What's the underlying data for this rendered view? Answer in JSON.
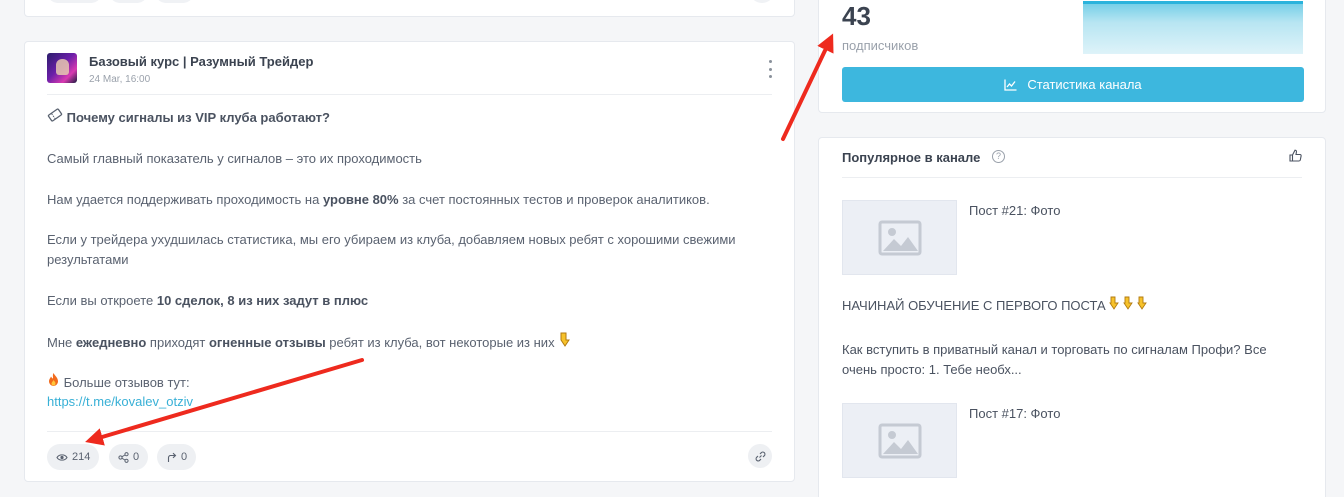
{
  "post": {
    "channel_name": "Базовый курс | Разумный Трейдер",
    "date": "24 Mar, 16:00",
    "heading": "Почему сигналы из VIP клуба работают?",
    "p1": "Самый главный показатель у сигналов – это их проходимость",
    "p2_before": "Нам удается поддерживать проходимость на ",
    "p2_bold": "уровне 80%",
    "p2_after": " за счет постоянных тестов и проверок аналитиков.",
    "p3_line1": "Если у трейдера ухудшилась статистика, мы его убираем из клуба, добавляем новых ребят с хорошими свежими",
    "p3_line2": "результатами",
    "p4_before": "Если вы откроете ",
    "p4_bold": "10 сделок, 8 из них задут в плюс",
    "p5_before": "Мне ",
    "p5_bold1": "ежедневно",
    "p5_mid1": " приходят ",
    "p5_bold2": "огненные отзывы",
    "p5_after": " ребят из клуба, вот некоторые из них",
    "more_label": "Больше отзывов тут:",
    "link": "https://t.me/kovalev_otziv",
    "views": "214",
    "shares": "0",
    "forwards": "0"
  },
  "stats": {
    "subscribers": "43",
    "subscribers_label": "подписчиков",
    "button_label": "Статистика канала"
  },
  "popular": {
    "title": "Популярное в канале",
    "items": [
      {
        "title": "Пост #21: Фото"
      },
      {
        "title": "Пост #17: Фото"
      }
    ],
    "text1": "НАЧИНАЙ ОБУЧЕНИЕ С ПЕРВОГО ПОСТА",
    "text2_line1": "Как вступить в приватный канал и торговать по сигналам Профи? Все",
    "text2_line2": "очень просто: 1. Тебе необх..."
  },
  "colors": {
    "accent": "#3db7de",
    "link": "#38b0d6",
    "arrow": "#ee2a1e"
  }
}
